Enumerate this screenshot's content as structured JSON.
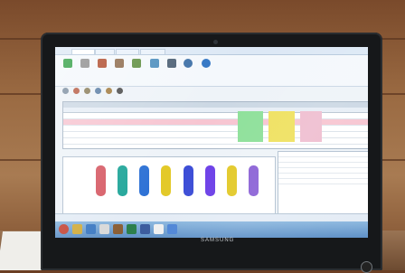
{
  "brand": "SAMSUNG",
  "colors": {
    "screen_bg": "#eef3f8",
    "green_block": "#8ee09a",
    "yellow_block": "#efe160",
    "pink_block": "#efbed0",
    "bar_red": "#d75d67",
    "bar_teal": "#22a69a",
    "bar_blue": "#2d71d5",
    "bar_yellow": "#e3c928",
    "bar_purple": "#6b3ee7"
  },
  "icons": [
    "camera-icon",
    "power-icon"
  ]
}
